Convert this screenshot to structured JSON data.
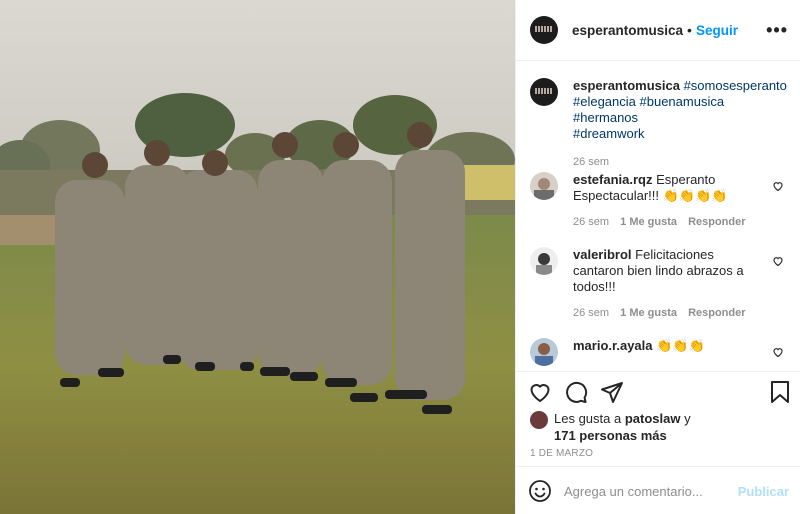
{
  "post": {
    "photo_alt": "",
    "author": {
      "username": "esperantomusica",
      "follow_label": "Seguir",
      "separator": "•",
      "more_label": "•••"
    },
    "caption": {
      "username": "esperantomusica",
      "hashtags": [
        "#somosesperanto",
        "#elegancia",
        "#buenamusica",
        "#hermanos",
        "#dreamwork"
      ],
      "time": "26 sem"
    },
    "comments": [
      {
        "username": "estefania.rqz",
        "text": "Esperanto Espectacular!!! 👏👏👏👏",
        "time": "26 sem",
        "likes": "1 Me gusta",
        "reply": "Responder"
      },
      {
        "username": "valeribrol",
        "text": "Felicitaciones cantaron bien lindo abrazos a todos!!!",
        "time": "26 sem",
        "likes": "1 Me gusta",
        "reply": "Responder"
      },
      {
        "username": "mario.r.ayala",
        "text": "👏👏👏",
        "time": "",
        "likes": "",
        "reply": ""
      }
    ],
    "likes": {
      "prefix": "Les gusta a",
      "first_user": "patoslaw",
      "joiner": "y",
      "others": "171 personas más"
    },
    "date": "1 DE MARZO",
    "add_comment": {
      "placeholder": "Agrega un comentario...",
      "post_label": "Publicar"
    }
  },
  "colors": {
    "accent": "#0095f6",
    "hashtag": "#00376b",
    "muted": "#8e8e8e"
  },
  "icons": [
    "heart-icon",
    "comment-icon",
    "share-icon",
    "bookmark-icon",
    "emoji-icon",
    "more-icon"
  ]
}
